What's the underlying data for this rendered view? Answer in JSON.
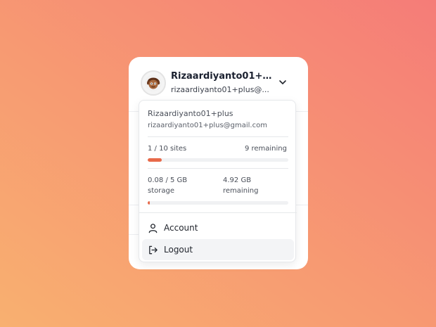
{
  "header": {
    "name": "Rizaardiyanto01+pl...",
    "email": "rizaardiyanto01+plus@..."
  },
  "popup": {
    "name": "Rizaardiyanto01+plus",
    "email": "rizaardiyanto01+plus@gmail.com",
    "sites": {
      "label": "1 / 10 sites",
      "remaining": "9 remaining",
      "used": 1,
      "total": 10
    },
    "storage": {
      "label": "0.08 / 5 GB storage",
      "remaining": "4.92 GB remaining",
      "used": 0.08,
      "total": 5
    },
    "menu": [
      {
        "label": "Account",
        "icon": "user-icon"
      },
      {
        "label": "Logout",
        "icon": "logout-icon"
      }
    ]
  },
  "colors": {
    "accent": "#e86a4a",
    "hover": "#f3f4f6"
  }
}
